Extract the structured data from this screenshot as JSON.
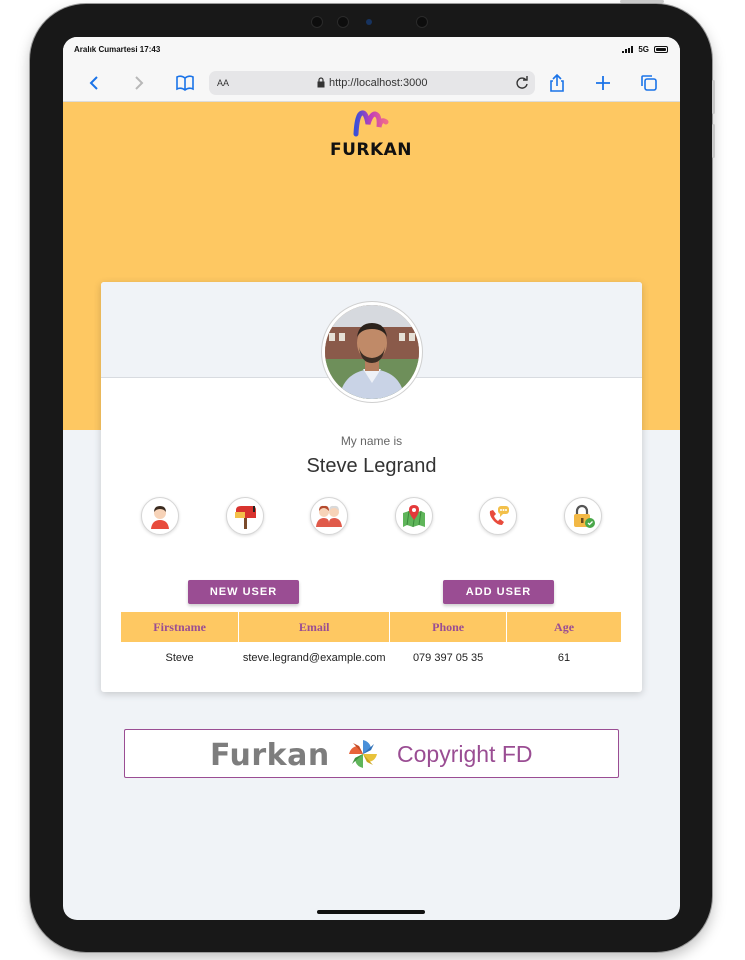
{
  "status_bar": {
    "time": "Aralık Cumartesi 17:43",
    "network": "5G"
  },
  "browser": {
    "text_size_label": "AA",
    "url": "http://localhost:3000"
  },
  "header": {
    "logo_text": "FURKAN"
  },
  "profile": {
    "subtitle": "My name is",
    "name": "Steve Legrand",
    "icons": [
      "user-icon",
      "mailbox-icon",
      "family-icon",
      "map-icon",
      "phone-icon",
      "lock-icon"
    ]
  },
  "actions": {
    "new_user_label": "NEW USER",
    "add_user_label": "ADD USER"
  },
  "table": {
    "headers": [
      "Firstname",
      "Email",
      "Phone",
      "Age"
    ],
    "rows": [
      [
        "Steve",
        "steve.legrand@example.com",
        "079 397 05 35",
        "61"
      ]
    ]
  },
  "footer": {
    "brand": "Furkan",
    "copyright": "Copyright FD"
  },
  "colors": {
    "accent": "#9a4d93",
    "hero": "#fec862",
    "page_bg": "#f0f3f7"
  }
}
